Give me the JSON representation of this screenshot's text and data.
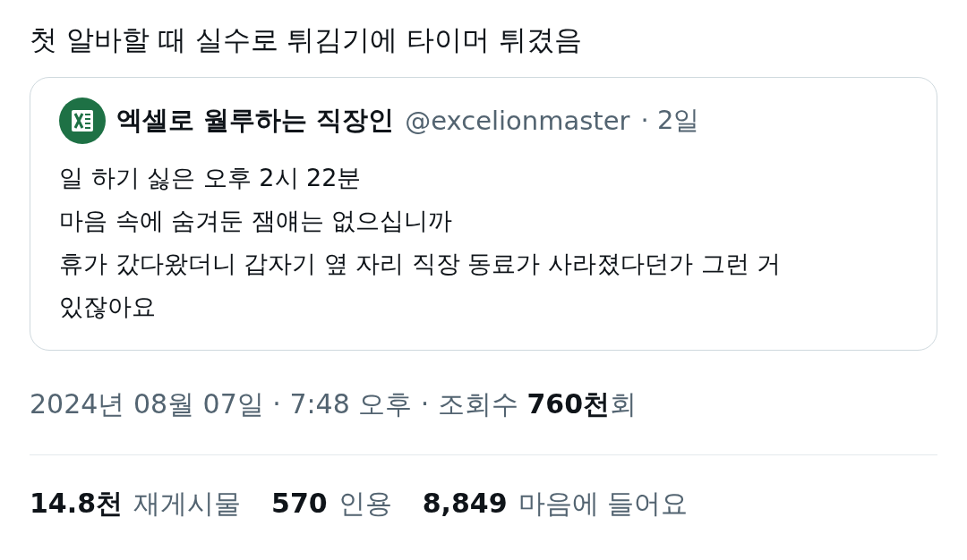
{
  "post": {
    "text": "첫 알바할 때 실수로 튀김기에 타이머 튀겼음"
  },
  "quote": {
    "author": "엑셀로 월루하는 직장인",
    "handle": "@excelionmaster",
    "time": "· 2일",
    "lines": [
      "일 하기 싫은 오후 2시 22분",
      "마음 속에 숨겨둔 잼얘는 없으십니까",
      "휴가 갔다왔더니 갑자기 옆 자리 직장 동료가 사라졌다던가 그런 거",
      "있잖아요"
    ]
  },
  "meta": {
    "text": "2024년 08월 07일 · 7:48 오후 · 조회수 **760천**회"
  },
  "stats": [
    {
      "count": "14.8천",
      "label": "재게시물"
    },
    {
      "count": "570",
      "label": "인용"
    },
    {
      "count": "8,849",
      "label": "마음에 들어요"
    }
  ]
}
